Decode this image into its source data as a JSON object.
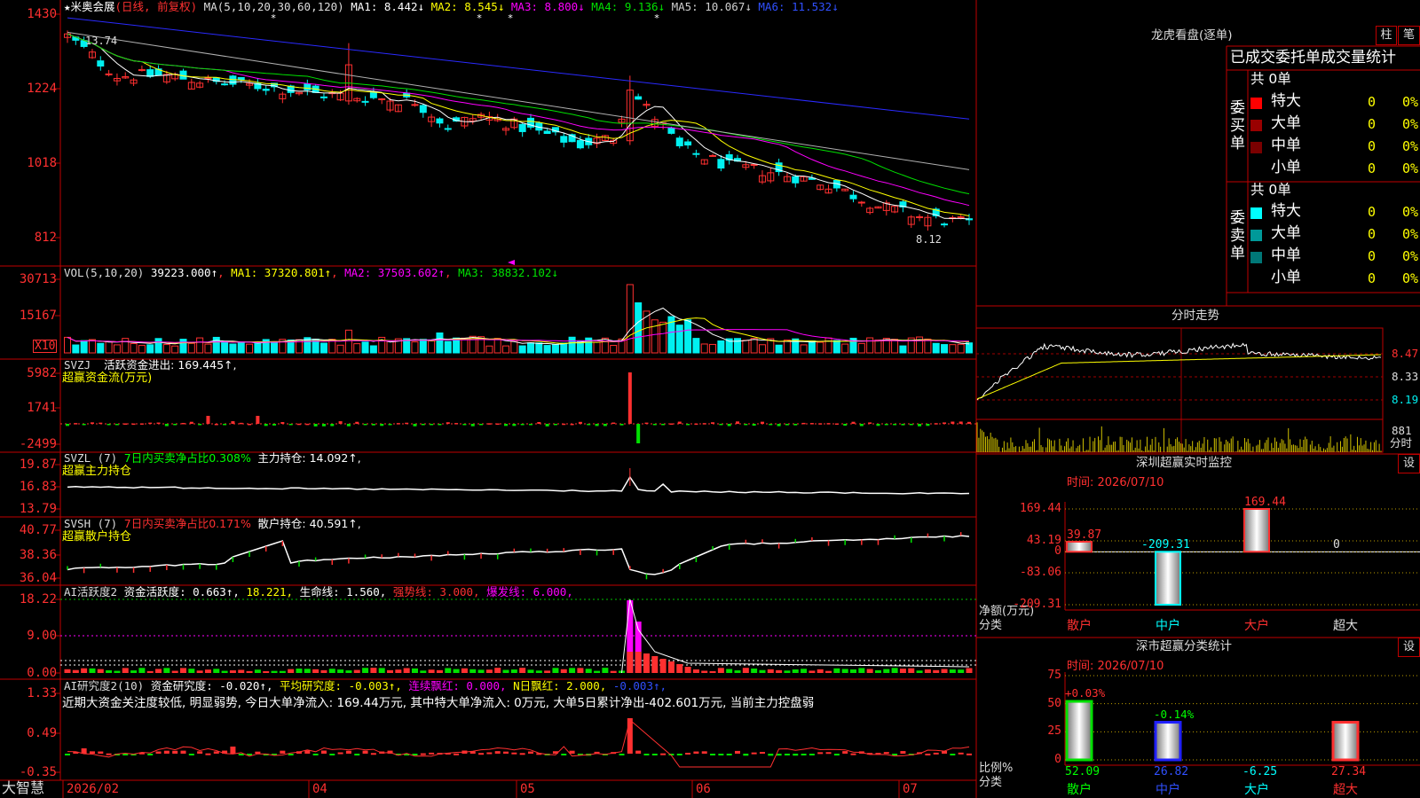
{
  "colors": {
    "up": "#ff3030",
    "down": "#00f0f0",
    "bg": "#000000",
    "grid": "#c00000",
    "axis": "#ff3333",
    "white": "#ffffff",
    "yellow": "#ffff00",
    "magenta": "#ff00ff",
    "green": "#00e000",
    "grey": "#a0a0a0",
    "blue": "#3030ff"
  },
  "stock": {
    "name": "★米奥会展",
    "period": "(日线, 前复权)"
  },
  "price_panel": {
    "legend": {
      "ma": "MA(5,10,20,30,60,120)",
      "ma1": "MA1: 8.442↓",
      "ma2": "MA2: 8.545↓",
      "ma3": "MA3: 8.800↓",
      "ma4": "MA4: 9.136↓",
      "ma5": "MA5: 10.067↓",
      "ma6": "MA6: 11.532↓"
    },
    "yticks": [
      "1430",
      "1224",
      "1018",
      "812"
    ],
    "high_label": "13.74",
    "low_label": "8.12"
  },
  "vol_panel": {
    "legend": {
      "name": "VOL(5,10,20)",
      "value": "39223.000↑",
      "ma1": "MA1: 37320.801↑",
      "ma2": "MA2: 37503.602↑",
      "ma3": "MA3: 38832.102↓"
    },
    "yticks": [
      "30713",
      "15167"
    ],
    "unit": "X10"
  },
  "svzj_panel": {
    "legend": {
      "name": "SVZJ",
      "item": "活跃资金进出: 169.445↑,",
      "sub": "超赢资金流(万元)"
    },
    "yticks": [
      "5982",
      "1741",
      "-2499"
    ]
  },
  "svzl_panel": {
    "legend": {
      "name": "SVZL (7)",
      "ratio": "7日内买卖净占比0.308%",
      "hold": "主力持仓: 14.092↑,",
      "sub": "超赢主力持仓"
    },
    "yticks": [
      "19.87",
      "16.83",
      "13.79"
    ]
  },
  "svsh_panel": {
    "legend": {
      "name": "SVSH (7)",
      "ratio": "7日内买卖净占比0.171%",
      "hold": "散户持仓: 40.591↑,",
      "sub": "超赢散户持仓"
    },
    "yticks": [
      "40.77",
      "38.36",
      "36.04"
    ]
  },
  "ai1_panel": {
    "legend": {
      "name": "AI活跃度2",
      "act": "资金活跃度: 0.663↑,",
      "v2": "18.221,",
      "life": "生命线: 1.560,",
      "strong": "强势线: 3.000,",
      "burst": "爆发线: 6.000,"
    },
    "yticks": [
      "18.22",
      "9.00",
      "0.00"
    ]
  },
  "ai2_panel": {
    "legend": {
      "name": "AI研究度2(10)",
      "res": "资金研究度: -0.020↑,",
      "avg": "平均研究度: -0.003↑,",
      "lian": "连续飘红: 0.000,",
      "nday": "N日飘红: 2.000,",
      "last": "-0.003↑,"
    },
    "comment": "近期大资金关注度较低, 明显弱势, 今日大单净流入: 169.44万元, 其中特大单净流入: 0万元, 大单5日累计净出-402.601万元, 当前主力控盘弱",
    "yticks": [
      "1.33",
      "0.49",
      "-0.35"
    ]
  },
  "xaxis": {
    "logo": "大智慧",
    "labels": [
      "2026/02",
      "04",
      "05",
      "06",
      "07"
    ]
  },
  "right": {
    "dragon": {
      "title": "龙虎看盘(逐单)",
      "btn1": "柱",
      "btn2": "笔",
      "header": "已成交委托单成交量统计",
      "buy": {
        "total": "共 0单",
        "side": "委买单",
        "rows": [
          {
            "label": "特大",
            "v": "0",
            "p": "0%"
          },
          {
            "label": "大单",
            "v": "0",
            "p": "0%"
          },
          {
            "label": "中单",
            "v": "0",
            "p": "0%"
          },
          {
            "label": "小单",
            "v": "0",
            "p": "0%"
          }
        ]
      },
      "sell": {
        "total": "共 0单",
        "side": "委卖单",
        "rows": [
          {
            "label": "特大",
            "v": "0",
            "p": "0%"
          },
          {
            "label": "大单",
            "v": "0",
            "p": "0%"
          },
          {
            "label": "中单",
            "v": "0",
            "p": "0%"
          },
          {
            "label": "小单",
            "v": "0",
            "p": "0%"
          }
        ]
      }
    },
    "intraday": {
      "title": "分时走势",
      "ticks": [
        "8.47",
        "8.33",
        "8.19"
      ],
      "vol": "881",
      "vol_unit": "分时"
    },
    "monitor": {
      "title": "深圳超赢实时监控",
      "btn": "设",
      "time": "时间: 2026/07/10",
      "yticks": [
        "169.44",
        "43.19",
        "0",
        "-83.06",
        "-209.31"
      ],
      "ylabel": "净额(万元)",
      "xlabel": "分类",
      "cats": [
        "散户",
        "中户",
        "大户",
        "超大"
      ],
      "vals": [
        "39.87",
        "-209.31",
        "169.44",
        "0"
      ]
    },
    "classify": {
      "title": "深市超赢分类统计",
      "btn": "设",
      "time": "时间: 2026/07/10",
      "yticks": [
        "75",
        "50",
        "25",
        "0"
      ],
      "ylabel": "比例%",
      "xlabel": "分类",
      "cats": [
        "散户",
        "中户",
        "大户",
        "超大"
      ],
      "pct": [
        "+0.03%",
        "-0.14%",
        "",
        ""
      ],
      "vals": [
        "52.09",
        "26.82",
        "-6.25",
        "27.34"
      ]
    }
  },
  "chart_data": [
    {
      "type": "candlestick",
      "panel": "price",
      "ylim": [
        8.12,
        14.3
      ],
      "yticks": [
        14.3,
        12.24,
        10.18,
        8.12
      ],
      "high": 13.74,
      "low": 8.12,
      "series": [
        {
          "name": "MA1",
          "value": 8.442
        },
        {
          "name": "MA2",
          "value": 8.545
        },
        {
          "name": "MA3",
          "value": 8.8
        },
        {
          "name": "MA4",
          "value": 9.136
        },
        {
          "name": "MA5",
          "value": 10.067
        },
        {
          "name": "MA6",
          "value": 11.532
        }
      ]
    },
    {
      "type": "bar",
      "panel": "volume",
      "yticks": [
        30713,
        15167
      ],
      "last": 39223.0,
      "series": [
        {
          "name": "MA1",
          "value": 37320.801
        },
        {
          "name": "MA2",
          "value": 37503.602
        },
        {
          "name": "MA3",
          "value": 38832.102
        }
      ]
    },
    {
      "type": "bar",
      "panel": "monitor",
      "categories": [
        "散户",
        "中户",
        "大户",
        "超大"
      ],
      "values": [
        39.87,
        -209.31,
        169.44,
        0
      ],
      "ylim": [
        -209.31,
        169.44
      ]
    },
    {
      "type": "bar",
      "panel": "classify",
      "categories": [
        "散户",
        "中户",
        "大户",
        "超大"
      ],
      "values": [
        52.09,
        26.82,
        -6.25,
        27.34
      ],
      "ylim": [
        0,
        75
      ]
    }
  ]
}
